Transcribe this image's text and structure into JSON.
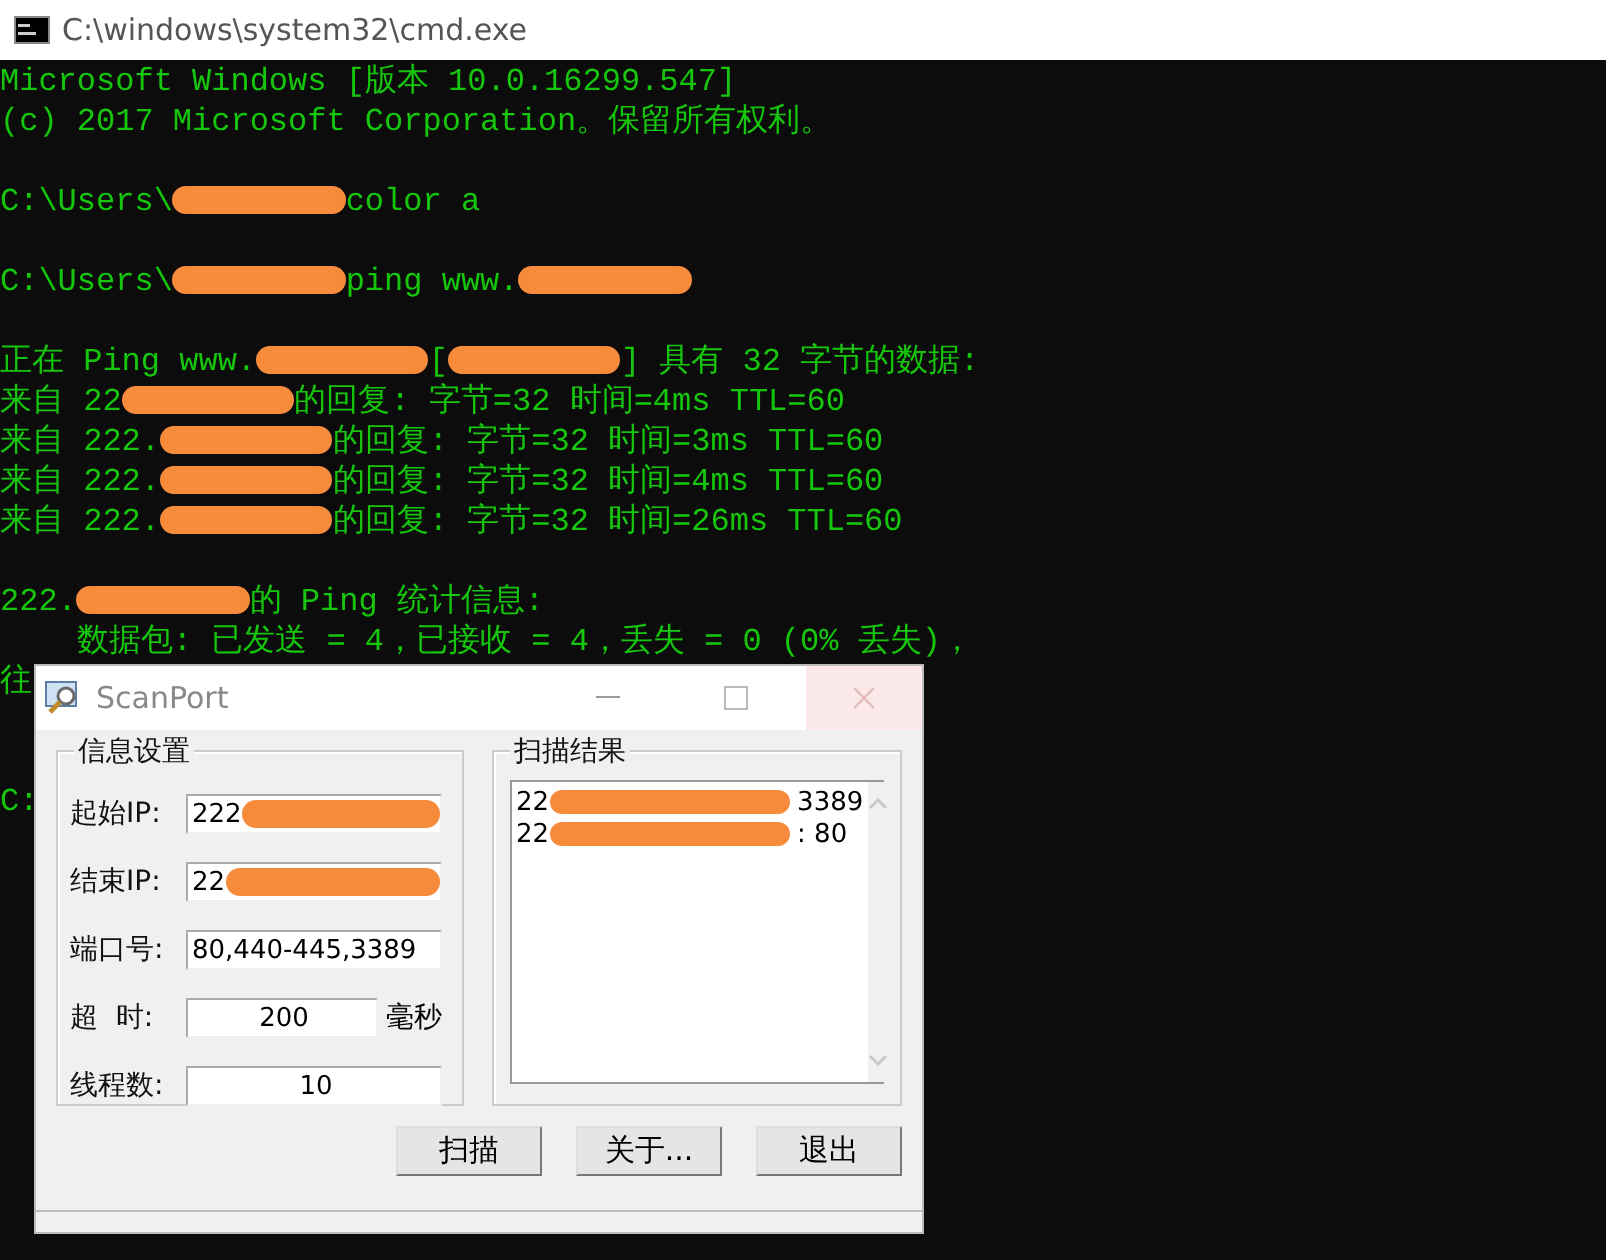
{
  "window": {
    "title": "C:\\windows\\system32\\cmd.exe"
  },
  "console": {
    "blocks": [
      {
        "lines": [
          {
            "parts": [
              {
                "kind": "text",
                "text": "Microsoft Windows [版本 10.0.16299.547]"
              }
            ]
          },
          {
            "parts": [
              {
                "kind": "text",
                "text": "(c) 2017 Microsoft Corporation。保留所有权利。"
              }
            ]
          }
        ]
      },
      {
        "lines": [
          {
            "parts": [
              {
                "kind": "text",
                "text": "C:\\Users\\"
              },
              {
                "kind": "redaction"
              },
              {
                "kind": "text",
                "text": "color a"
              }
            ]
          }
        ]
      },
      {
        "lines": [
          {
            "parts": [
              {
                "kind": "text",
                "text": "C:\\Users\\"
              },
              {
                "kind": "redaction"
              },
              {
                "kind": "text",
                "text": "ping www."
              },
              {
                "kind": "redaction"
              }
            ]
          }
        ]
      },
      {
        "lines": [
          {
            "parts": [
              {
                "kind": "text",
                "text": "正在 Ping www."
              },
              {
                "kind": "redaction"
              },
              {
                "kind": "text",
                "text": "["
              },
              {
                "kind": "redaction"
              },
              {
                "kind": "text",
                "text": "] 具有 32 字节的数据:"
              }
            ]
          },
          {
            "parts": [
              {
                "kind": "text",
                "text": "来自 22"
              },
              {
                "kind": "redaction"
              },
              {
                "kind": "text",
                "text": "的回复: 字节=32 时间=4ms TTL=60"
              }
            ]
          },
          {
            "parts": [
              {
                "kind": "text",
                "text": "来自 222."
              },
              {
                "kind": "redaction"
              },
              {
                "kind": "text",
                "text": "的回复: 字节=32 时间=3ms TTL=60"
              }
            ]
          },
          {
            "parts": [
              {
                "kind": "text",
                "text": "来自 222."
              },
              {
                "kind": "redaction"
              },
              {
                "kind": "text",
                "text": "的回复: 字节=32 时间=4ms TTL=60"
              }
            ]
          },
          {
            "parts": [
              {
                "kind": "text",
                "text": "来自 222."
              },
              {
                "kind": "redaction"
              },
              {
                "kind": "text",
                "text": "的回复: 字节=32 时间=26ms TTL=60"
              }
            ]
          }
        ]
      },
      {
        "lines": [
          {
            "parts": [
              {
                "kind": "text",
                "text": "222."
              },
              {
                "kind": "redaction"
              },
              {
                "kind": "text",
                "text": "的 Ping 统计信息:"
              }
            ]
          },
          {
            "parts": [
              {
                "kind": "text",
                "text": "    数据包: 已发送 = 4，已接收 = 4，丢失 = 0 (0% 丢失)，"
              }
            ]
          },
          {
            "parts": [
              {
                "kind": "text",
                "text": "往"
              }
            ]
          }
        ]
      },
      {
        "lines": [
          {
            "parts": [
              {
                "kind": "text",
                "text": "C:"
              }
            ]
          }
        ]
      }
    ]
  },
  "dialog": {
    "title": "ScanPort",
    "settings": {
      "title": "信息设置",
      "fields": [
        {
          "label": "起始IP:",
          "parts": [
            {
              "kind": "text",
              "text": "222"
            },
            {
              "kind": "redaction"
            }
          ]
        },
        {
          "label": "结束IP:",
          "parts": [
            {
              "kind": "text",
              "text": "22"
            },
            {
              "kind": "redaction"
            }
          ]
        },
        {
          "label": "端口号:",
          "parts": [
            {
              "kind": "text",
              "text": "80,440-445,3389"
            }
          ]
        },
        {
          "label": "超  时:",
          "parts": [
            {
              "kind": "text",
              "text": "200"
            }
          ],
          "unit": "毫秒"
        },
        {
          "label": "线程数:",
          "parts": [
            {
              "kind": "text",
              "text": "10"
            }
          ]
        }
      ]
    },
    "results": {
      "title": "扫描结果",
      "rows": [
        {
          "parts": [
            {
              "kind": "text",
              "text": "22"
            },
            {
              "kind": "redaction"
            },
            {
              "kind": "text",
              "text": "3389"
            }
          ]
        },
        {
          "parts": [
            {
              "kind": "text",
              "text": "22"
            },
            {
              "kind": "redaction"
            },
            {
              "kind": "text",
              "text": ": 80"
            }
          ]
        }
      ]
    },
    "buttons": [
      "扫描",
      "关于...",
      "退出"
    ]
  }
}
